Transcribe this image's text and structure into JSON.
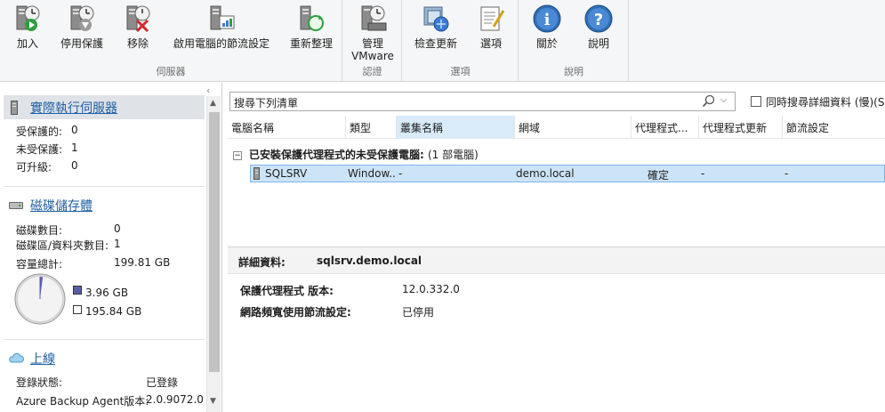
{
  "ribbon": {
    "groups": [
      {
        "label": "伺服器",
        "buttons": [
          "加入",
          "停用保護",
          "移除",
          "啟用電腦的節流設定",
          "重新整理"
        ]
      },
      {
        "label": "認證",
        "buttons": [
          "管理\nVMware"
        ]
      },
      {
        "label": "選項",
        "buttons": [
          "檢查更新",
          "選項"
        ]
      },
      {
        "label": "說明",
        "buttons": [
          "關於",
          "說明"
        ]
      }
    ],
    "btn_add": "加入",
    "btn_disable": "停用保護",
    "btn_remove": "移除",
    "btn_throttle": "啟用電腦的節流設定",
    "btn_refresh": "重新整理",
    "btn_vmware_1": "管理",
    "btn_vmware_2": "VMware",
    "btn_update": "檢查更新",
    "btn_options": "選項",
    "btn_about": "關於",
    "btn_help": "說明",
    "grp_server": "伺服器",
    "grp_cred": "認證",
    "grp_options": "選項",
    "grp_help": "說明"
  },
  "left": {
    "servers": {
      "title": "實際執行伺服器",
      "protected_label": "受保護的:",
      "protected_value": "0",
      "unprotected_label": "未受保護:",
      "unprotected_value": "1",
      "upgradable_label": "可升級:",
      "upgradable_value": "0"
    },
    "storage": {
      "title": "磁碟儲存體",
      "disks_label": "磁碟數目:",
      "disks_value": "0",
      "volumes_label": "磁碟區/資料夾數目:",
      "volumes_value": "1",
      "capacity_label": "容量總計:",
      "capacity_value": "199.81 GB",
      "used": "3.96 GB",
      "free": "195.84 GB",
      "used_fraction": 0.0198,
      "used_color": "#5b5ea6"
    },
    "online": {
      "title": "上線",
      "reg_label": "登錄狀態:",
      "reg_value": "已登錄",
      "agent_label": "Azure Backup Agent版本:",
      "agent_value": "2.0.9072.0"
    }
  },
  "search": {
    "text": "搜尋下列清單",
    "checkbox_label": "同時搜尋詳細資料 (慢)(S)"
  },
  "table": {
    "columns": [
      "電腦名稱",
      "類型",
      "叢集名稱",
      "網域",
      "代理程式...",
      "代理程式更新",
      "節流設定"
    ],
    "group_header": "已安裝保護代理程式的未受保護電腦:",
    "group_count": "(1 部電腦)",
    "group_toggle": "−",
    "rows": [
      {
        "name": "SQLSRV",
        "type": "Window...",
        "cluster": "-",
        "domain": "demo.local",
        "agent": "確定",
        "update": "-",
        "throttle": "-"
      }
    ]
  },
  "details": {
    "label": "詳細資料:",
    "value": "sqlsrv.demo.local",
    "agent_version_label": "保護代理程式 版本:",
    "agent_version_value": "12.0.332.0",
    "throttle_label": "網路頻寬使用節流設定:",
    "throttle_value": "已停用"
  }
}
